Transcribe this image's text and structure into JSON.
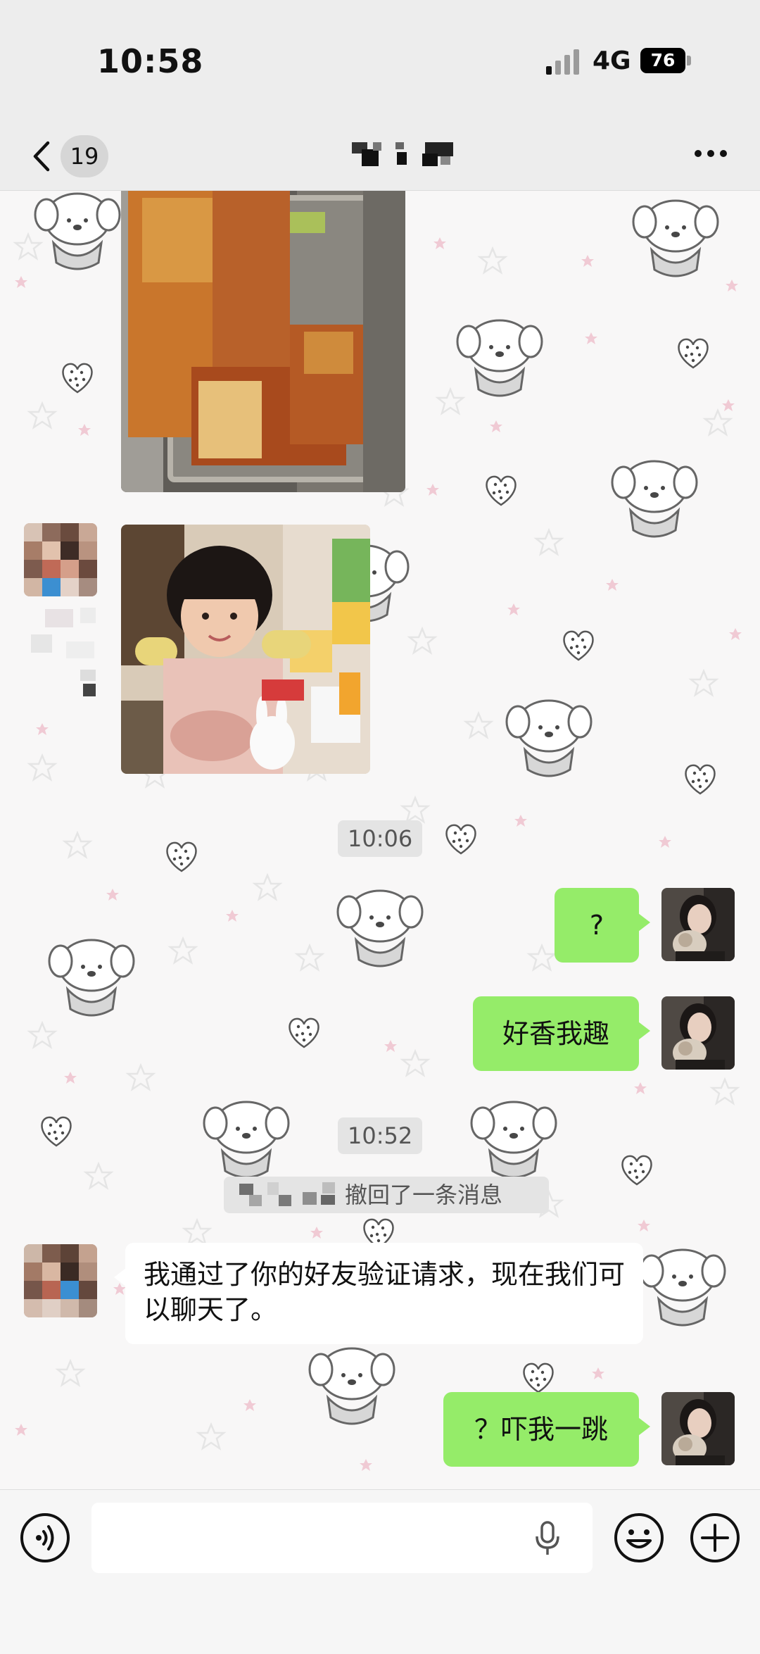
{
  "status_bar": {
    "time": "10:58",
    "network": "4G",
    "battery": "76"
  },
  "nav": {
    "unread_count": "19",
    "title": ""
  },
  "messages": {
    "time_1": "10:06",
    "out_1": "?",
    "out_2": "好香我趣",
    "time_2": "10:52",
    "recall_notice": "撤回了一条消息",
    "in_1": "我通过了你的好友验证请求，现在我们可以聊天了。",
    "out_3": "？吓我一跳"
  },
  "input": {
    "placeholder": ""
  },
  "colors": {
    "outgoing_bubble": "#95ec69",
    "incoming_bubble": "#ffffff",
    "bar_background": "#ededed"
  },
  "icons": [
    "chevron-left-icon",
    "more-icon",
    "voice-icon",
    "mic-icon",
    "emoji-icon",
    "plus-icon"
  ]
}
